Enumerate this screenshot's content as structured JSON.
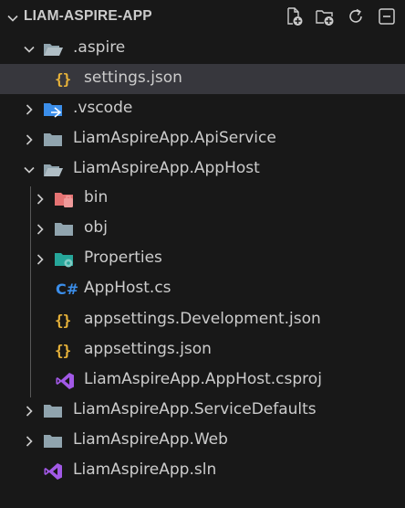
{
  "explorer": {
    "title": "LIAM-ASPIRE-APP",
    "actions": [
      {
        "name": "new-file-icon"
      },
      {
        "name": "new-folder-icon"
      },
      {
        "name": "refresh-icon"
      },
      {
        "name": "collapse-all-icon"
      }
    ],
    "items": [
      {
        "label": ".aspire",
        "type": "folder",
        "expanded": true
      },
      {
        "label": "settings.json",
        "type": "json",
        "selected": true
      },
      {
        "label": ".vscode",
        "type": "vscode-folder",
        "expanded": false
      },
      {
        "label": "LiamAspireApp.ApiService",
        "type": "folder",
        "expanded": false
      },
      {
        "label": "LiamAspireApp.AppHost",
        "type": "folder",
        "expanded": true
      },
      {
        "label": "bin",
        "type": "bin-folder",
        "expanded": false
      },
      {
        "label": "obj",
        "type": "folder",
        "expanded": false
      },
      {
        "label": "Properties",
        "type": "properties-folder",
        "expanded": false
      },
      {
        "label": "AppHost.cs",
        "type": "csharp"
      },
      {
        "label": "appsettings.Development.json",
        "type": "json"
      },
      {
        "label": "appsettings.json",
        "type": "json"
      },
      {
        "label": "LiamAspireApp.AppHost.csproj",
        "type": "csproj"
      },
      {
        "label": "LiamAspireApp.ServiceDefaults",
        "type": "folder",
        "expanded": false
      },
      {
        "label": "LiamAspireApp.Web",
        "type": "folder",
        "expanded": false
      },
      {
        "label": "LiamAspireApp.sln",
        "type": "sln"
      }
    ]
  },
  "colors": {
    "background": "#181818",
    "selected": "#37373d",
    "folder": "#90a4ae",
    "json": "#e8b33a",
    "csharp": "#3b8eea",
    "visualstudio": "#a259e6",
    "vscode": "#3b8eea",
    "bin": "#e57373",
    "properties": "#26a69a"
  }
}
